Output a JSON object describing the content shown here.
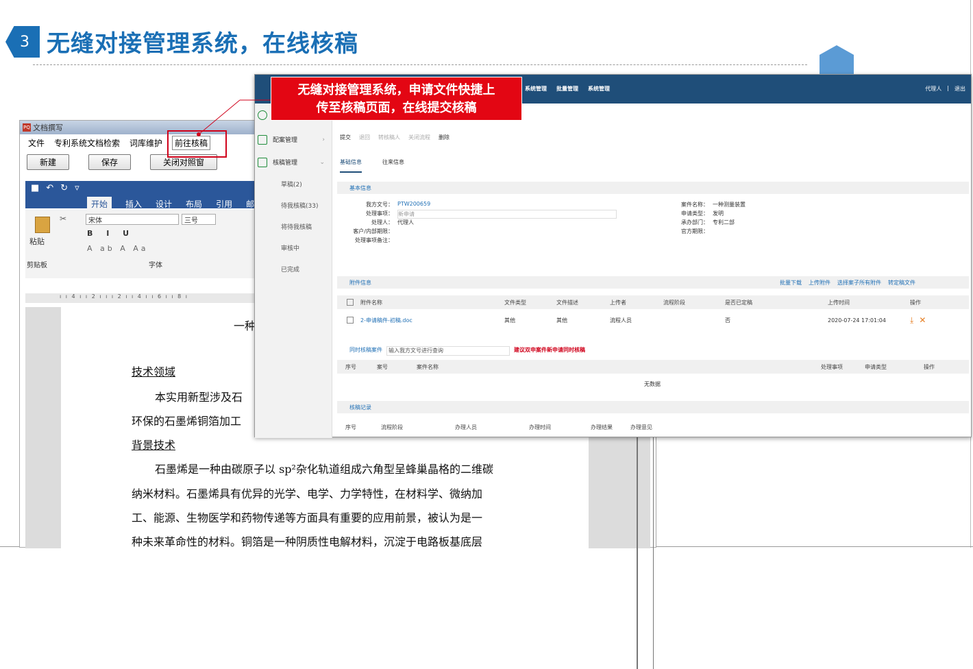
{
  "slide": {
    "number": "3",
    "title": "无缝对接管理系统，在线核稿"
  },
  "callout": {
    "line1": "无缝对接管理系统，申请文件快捷上",
    "line2": "传至核稿页面，在线提交核稿"
  },
  "word": {
    "title": "文档撰写",
    "menu": [
      "文件",
      "专利系统文档检索",
      "词库维护",
      "前往核稿"
    ],
    "buttons": [
      "新建",
      "保存",
      "关闭对照窗"
    ],
    "ribbon_tabs": [
      "开始",
      "插入",
      "设计",
      "布局",
      "引用",
      "邮"
    ],
    "font_name": "宋体",
    "font_size": "三号",
    "group_labels": [
      "剪贴板",
      "字体"
    ],
    "paste_label": "粘贴",
    "heading_partial": "一种",
    "doc_lines": [
      "技术领域",
      "本实用新型涉及石",
      "环保的石墨烯铜箔加工",
      "背景技术",
      "石墨烯是一种由碳原子以 sp²杂化轨道组成六角型呈蜂巢晶格的二维碳",
      "纳米材料。石墨烯具有优异的光学、电学、力学特性，在材料学、微纳加",
      "工、能源、生物医学和药物传递等方面具有重要的应用前景，被认为是一",
      "种未来革命性的材料。铜箔是一种阴质性电解材料，沉淀于电路板基底层"
    ]
  },
  "system": {
    "nav": [
      "系统管理",
      "批量管理",
      "系统管理"
    ],
    "user": "代理人",
    "logout": "退出",
    "sidebar": {
      "items": [
        {
          "label": "配案管理"
        },
        {
          "label": "核稿管理"
        }
      ],
      "sub": [
        "草稿(2)",
        "待我核稿(33)",
        "将待我核稿",
        "审核中",
        "已完成"
      ]
    },
    "toolbar": [
      "提交",
      "退回",
      "转核稿人",
      "关闭流程",
      "删除"
    ],
    "tabs": [
      "基础信息",
      "往来信息"
    ],
    "basic": {
      "title": "基本信息",
      "left": [
        {
          "k": "我方文号：",
          "v": "PTW200659"
        },
        {
          "k": "处理事项：",
          "v": "新申请"
        },
        {
          "k": "处理人：",
          "v": "代理人"
        },
        {
          "k": "客户/内部期限：",
          "v": ""
        },
        {
          "k": "处理事项备注：",
          "v": ""
        }
      ],
      "right": [
        {
          "k": "案件名称：",
          "v": "一种测量装置"
        },
        {
          "k": "申请类型：",
          "v": "发明"
        },
        {
          "k": "承办部门：",
          "v": "专利二部"
        },
        {
          "k": "官方期限：",
          "v": ""
        }
      ]
    },
    "attach": {
      "title": "附件信息",
      "actions": [
        "批量下载",
        "上传附件",
        "选择案子所有附件",
        "转定稿文件"
      ],
      "headers": [
        "附件名称",
        "文件类型",
        "文件描述",
        "上传者",
        "流程阶段",
        "是否已定稿",
        "上传时间",
        "操作"
      ],
      "row": {
        "name": "2-申请稿件-初稿.doc",
        "type": "其他",
        "desc": "其他",
        "uploader": "流程人员",
        "stage": "",
        "final": "否",
        "time": "2020-07-24 17:01:04"
      }
    },
    "related": {
      "title": "同时核稿案件",
      "placeholder": "输入我方文号进行查询",
      "hint": "建议双申案件新申请同时核稿",
      "headers": [
        "序号",
        "案号",
        "案件名称",
        "处理事项",
        "申请类型",
        "操作"
      ],
      "empty": "无数据"
    },
    "records": {
      "title": "核稿记录",
      "headers": [
        "序号",
        "流程阶段",
        "办理人员",
        "办理时间",
        "办理结果",
        "办理意见"
      ]
    }
  }
}
